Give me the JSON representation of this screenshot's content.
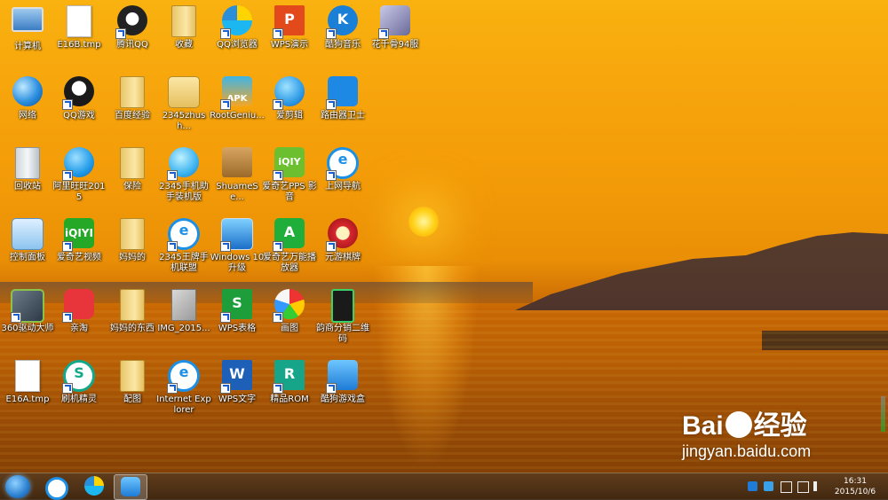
{
  "desktop": {
    "col1": [
      {
        "label": "计算机",
        "name": "computer-icon"
      },
      {
        "label": "网络",
        "name": "network-icon"
      },
      {
        "label": "回收站",
        "name": "recycle-bin-icon"
      },
      {
        "label": "控制面板",
        "name": "control-panel-icon"
      },
      {
        "label": "360驱动大师",
        "name": "360-driver-icon"
      },
      {
        "label": "E16A.tmp",
        "name": "tmp-file-icon"
      }
    ],
    "col2": [
      {
        "label": "E16B.tmp",
        "name": "tmp-file-icon"
      },
      {
        "label": "QQ游戏",
        "name": "qq-game-icon"
      },
      {
        "label": "阿里旺旺2015",
        "name": "aliwangwang-icon"
      },
      {
        "label": "爱奇艺视频",
        "name": "iqiyi-icon"
      },
      {
        "label": "亲淘",
        "name": "qintao-icon"
      },
      {
        "label": "刷机精灵",
        "name": "shuaji-icon"
      }
    ],
    "col3": [
      {
        "label": "腾讯QQ",
        "name": "qq-icon"
      },
      {
        "label": "百度经验",
        "name": "folder-icon"
      },
      {
        "label": "保险",
        "name": "folder-icon"
      },
      {
        "label": "妈妈的",
        "name": "folder-icon"
      },
      {
        "label": "妈妈的东西",
        "name": "folder-icon"
      },
      {
        "label": "配图",
        "name": "folder-icon"
      }
    ],
    "col4": [
      {
        "label": "收藏",
        "name": "folder-icon"
      },
      {
        "label": "2345zhush...",
        "name": "zhushou-icon"
      },
      {
        "label": "2345手机助手装机版",
        "name": "phone-assistant-icon"
      },
      {
        "label": "2345王牌手机联盟",
        "name": "ie-icon"
      },
      {
        "label": "IMG_2015...",
        "name": "image-file-icon"
      },
      {
        "label": "Internet Explorer",
        "name": "ie-icon"
      }
    ],
    "col5": [
      {
        "label": "QQ浏览器",
        "name": "qq-browser-icon"
      },
      {
        "label": "RootGeniu...",
        "name": "apk-icon"
      },
      {
        "label": "ShuameSe...",
        "name": "box-icon"
      },
      {
        "label": "Windows 10 升级",
        "name": "upgrade-icon"
      },
      {
        "label": "WPS表格",
        "name": "wps-sheet-icon"
      },
      {
        "label": "WPS文字",
        "name": "wps-writer-icon"
      }
    ],
    "col6": [
      {
        "label": "WPS演示",
        "name": "wps-present-icon"
      },
      {
        "label": "爱剪辑",
        "name": "ijianji-icon"
      },
      {
        "label": "爱奇艺PPS 影音",
        "name": "pps-icon"
      },
      {
        "label": "爱奇艺万能播放器",
        "name": "player-icon"
      },
      {
        "label": "画图",
        "name": "paint-icon"
      },
      {
        "label": "精品ROM",
        "name": "rom-icon"
      }
    ],
    "col7": [
      {
        "label": "酷狗音乐",
        "name": "kugou-icon"
      },
      {
        "label": "路由器卫士",
        "name": "router-icon"
      },
      {
        "label": "上网导航",
        "name": "ie-icon"
      },
      {
        "label": "元游棋牌",
        "name": "yuanyou-icon"
      },
      {
        "label": "韵商分销二维码",
        "name": "qrcode-icon"
      },
      {
        "label": "酷狗游戏盒",
        "name": "kugou-game-icon"
      }
    ],
    "col8": [
      {
        "label": "花千骨94服",
        "name": "game-icon"
      }
    ]
  },
  "watermark": {
    "logo_left": "Bai",
    "logo_right": "经验",
    "url": "jingyan.baidu.com"
  },
  "taskbar": {
    "time": "16:31",
    "date": "2015/10/6"
  },
  "colors": {
    "qq": "#1a1a1a",
    "wps_red": "#e24a1c",
    "wps_green": "#1e9e3b",
    "wps_blue": "#1e5fb8",
    "iqiyi": "#2aaa2a",
    "blue": "#1c6fd6"
  }
}
